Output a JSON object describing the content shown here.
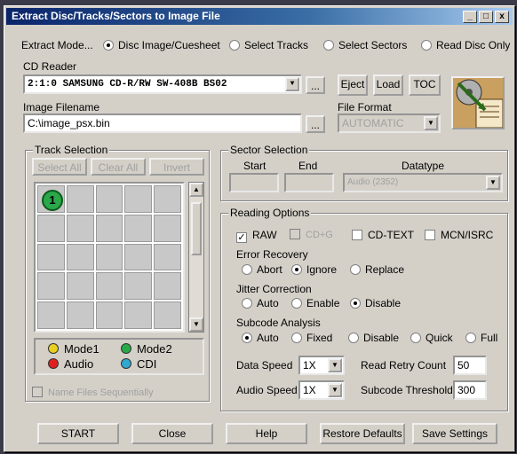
{
  "window": {
    "title": "Extract Disc/Tracks/Sectors to Image File",
    "min": "_",
    "max": "□",
    "close": "x"
  },
  "extract_mode": {
    "label": "Extract Mode...",
    "options": [
      "Disc Image/Cuesheet",
      "Select Tracks",
      "Select Sectors",
      "Read Disc Only"
    ],
    "selected": "Disc Image/Cuesheet"
  },
  "cd_reader": {
    "label": "CD Reader",
    "value": "2:1:0 SAMSUNG  CD-R/RW SW-408B  BS02",
    "browse": "...",
    "eject": "Eject",
    "load": "Load",
    "toc": "TOC"
  },
  "image_filename": {
    "label": "Image Filename",
    "value": "C:\\image_psx.bin",
    "browse": "..."
  },
  "file_format": {
    "label": "File Format",
    "value": "AUTOMATIC"
  },
  "track_selection": {
    "title": "Track Selection",
    "select_all": "Select All",
    "clear_all": "Clear All",
    "invert": "Invert",
    "tracks": [
      "1"
    ],
    "legend": [
      {
        "label": "Mode1",
        "color": "#e8d020"
      },
      {
        "label": "Mode2",
        "color": "#2aa84a"
      },
      {
        "label": "Audio",
        "color": "#e02020"
      },
      {
        "label": "CDI",
        "color": "#30a8d0"
      }
    ],
    "name_files": "Name Files Sequentially"
  },
  "sector_selection": {
    "title": "Sector Selection",
    "start": "Start",
    "end": "End",
    "datatype": "Datatype",
    "datatype_value": "Audio (2352)"
  },
  "reading_options": {
    "title": "Reading Options",
    "raw": "RAW",
    "cdg": "CD+G",
    "cdtext": "CD-TEXT",
    "mcn": "MCN/ISRC",
    "error_recovery": {
      "label": "Error Recovery",
      "options": [
        "Abort",
        "Ignore",
        "Replace"
      ],
      "selected": "Ignore"
    },
    "jitter": {
      "label": "Jitter Correction",
      "options": [
        "Auto",
        "Enable",
        "Disable"
      ],
      "selected": "Disable"
    },
    "subcode": {
      "label": "Subcode Analysis",
      "options": [
        "Auto",
        "Fixed",
        "Disable",
        "Quick",
        "Full"
      ],
      "selected": "Auto"
    },
    "data_speed": {
      "label": "Data Speed",
      "value": "1X"
    },
    "audio_speed": {
      "label": "Audio Speed",
      "value": "1X"
    },
    "read_retry": {
      "label": "Read Retry Count",
      "value": "50"
    },
    "subcode_threshold": {
      "label": "Subcode Threshold",
      "value": "300"
    }
  },
  "footer": {
    "start": "START",
    "close": "Close",
    "help": "Help",
    "restore": "Restore Defaults",
    "save": "Save Settings"
  }
}
